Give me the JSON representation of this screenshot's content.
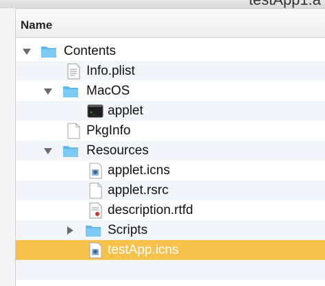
{
  "window": {
    "title": "testApp1.a"
  },
  "header": {
    "name_column": "Name"
  },
  "rows": [
    {
      "label": "Contents",
      "icon": "folder-icon",
      "disclosure": "expanded",
      "level": 0
    },
    {
      "label": "Info.plist",
      "icon": "plist-file-icon",
      "disclosure": "none",
      "level": 1
    },
    {
      "label": "MacOS",
      "icon": "folder-icon",
      "disclosure": "expanded",
      "level": 1
    },
    {
      "label": "applet",
      "icon": "terminal-executable-icon",
      "disclosure": "none",
      "level": 2
    },
    {
      "label": "PkgInfo",
      "icon": "blank-document-icon",
      "disclosure": "none",
      "level": 1
    },
    {
      "label": "Resources",
      "icon": "folder-icon",
      "disclosure": "expanded",
      "level": 1
    },
    {
      "label": "applet.icns",
      "icon": "icns-file-icon",
      "disclosure": "none",
      "level": 2
    },
    {
      "label": "applet.rsrc",
      "icon": "blank-document-icon",
      "disclosure": "none",
      "level": 2
    },
    {
      "label": "description.rtfd",
      "icon": "rtfd-document-icon",
      "disclosure": "none",
      "level": 2
    },
    {
      "label": "Scripts",
      "icon": "folder-icon",
      "disclosure": "collapsed",
      "level": 2
    },
    {
      "label": "testApp.icns",
      "icon": "icns-file-icon",
      "disclosure": "none",
      "level": 2,
      "selected": true
    }
  ],
  "colors": {
    "selection": "#f7c24c",
    "folder": "#6cc3f2",
    "stripe": "#f2f5fa"
  }
}
